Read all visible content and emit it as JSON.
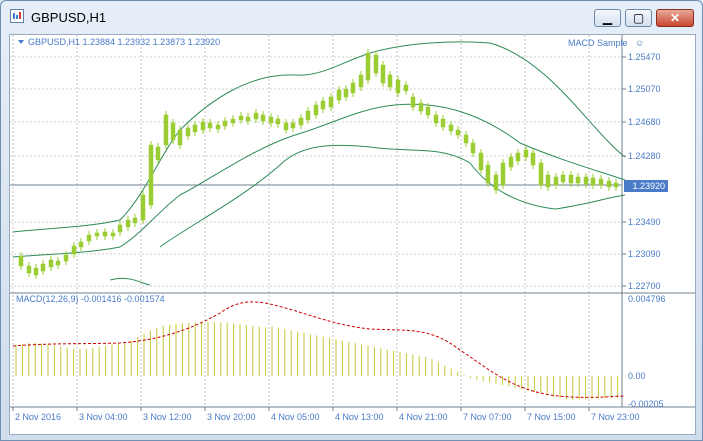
{
  "window": {
    "title": "GBPUSD,H1",
    "minimize_glyph": "▁",
    "maximize_glyph": "▢",
    "close_glyph": "✕",
    "icon": "chart-window-icon"
  },
  "chart": {
    "symbol_line": "GBPUSD,H1  1.23884 1.23932 1.23873 1.23920",
    "expert_label": "MACD Sample",
    "smiley": "☺",
    "current_price": "1.23920",
    "price_ticks": [
      "1.25470",
      "1.25070",
      "1.24680",
      "1.24280",
      "1.23490",
      "1.23090",
      "1.22700"
    ],
    "macd_label": "MACD(12,26,9) -0.001416 -0.001574",
    "macd_ticks": [
      "0.004796",
      "0.00",
      "-0.00205"
    ],
    "time_labels": [
      "2 Nov 2016",
      "3 Nov 04:00",
      "3 Nov 12:00",
      "3 Nov 20:00",
      "4 Nov 05:00",
      "4 Nov 13:00",
      "4 Nov 21:00",
      "7 Nov 07:00",
      "7 Nov 15:00",
      "7 Nov 23:00"
    ],
    "colors": {
      "candle": "#9acd32",
      "bands": "#2e8b57",
      "signal": "#cc0000",
      "histogram": "#c8c830",
      "grid": "#a0a0a0",
      "labels": "#4a7bc8"
    }
  }
}
